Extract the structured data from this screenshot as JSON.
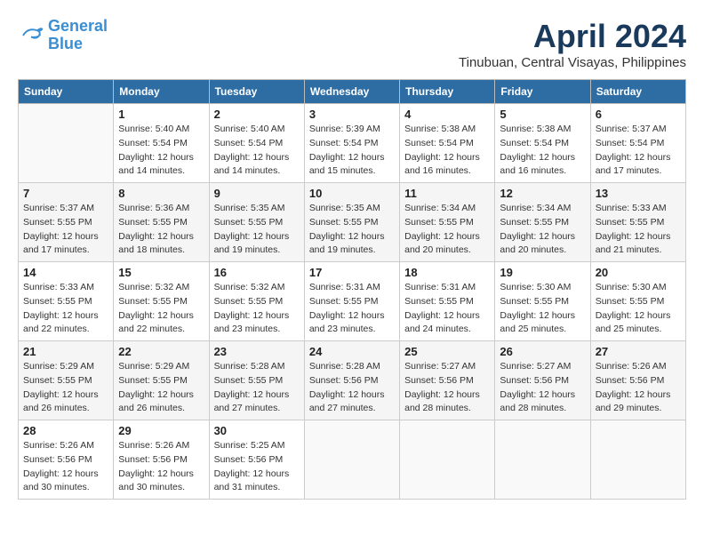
{
  "header": {
    "logo_line1": "General",
    "logo_line2": "Blue",
    "month": "April 2024",
    "location": "Tinubuan, Central Visayas, Philippines"
  },
  "days_of_week": [
    "Sunday",
    "Monday",
    "Tuesday",
    "Wednesday",
    "Thursday",
    "Friday",
    "Saturday"
  ],
  "weeks": [
    [
      {
        "day": "",
        "info": ""
      },
      {
        "day": "1",
        "info": "Sunrise: 5:40 AM\nSunset: 5:54 PM\nDaylight: 12 hours\nand 14 minutes."
      },
      {
        "day": "2",
        "info": "Sunrise: 5:40 AM\nSunset: 5:54 PM\nDaylight: 12 hours\nand 14 minutes."
      },
      {
        "day": "3",
        "info": "Sunrise: 5:39 AM\nSunset: 5:54 PM\nDaylight: 12 hours\nand 15 minutes."
      },
      {
        "day": "4",
        "info": "Sunrise: 5:38 AM\nSunset: 5:54 PM\nDaylight: 12 hours\nand 16 minutes."
      },
      {
        "day": "5",
        "info": "Sunrise: 5:38 AM\nSunset: 5:54 PM\nDaylight: 12 hours\nand 16 minutes."
      },
      {
        "day": "6",
        "info": "Sunrise: 5:37 AM\nSunset: 5:54 PM\nDaylight: 12 hours\nand 17 minutes."
      }
    ],
    [
      {
        "day": "7",
        "info": "Sunrise: 5:37 AM\nSunset: 5:55 PM\nDaylight: 12 hours\nand 17 minutes."
      },
      {
        "day": "8",
        "info": "Sunrise: 5:36 AM\nSunset: 5:55 PM\nDaylight: 12 hours\nand 18 minutes."
      },
      {
        "day": "9",
        "info": "Sunrise: 5:35 AM\nSunset: 5:55 PM\nDaylight: 12 hours\nand 19 minutes."
      },
      {
        "day": "10",
        "info": "Sunrise: 5:35 AM\nSunset: 5:55 PM\nDaylight: 12 hours\nand 19 minutes."
      },
      {
        "day": "11",
        "info": "Sunrise: 5:34 AM\nSunset: 5:55 PM\nDaylight: 12 hours\nand 20 minutes."
      },
      {
        "day": "12",
        "info": "Sunrise: 5:34 AM\nSunset: 5:55 PM\nDaylight: 12 hours\nand 20 minutes."
      },
      {
        "day": "13",
        "info": "Sunrise: 5:33 AM\nSunset: 5:55 PM\nDaylight: 12 hours\nand 21 minutes."
      }
    ],
    [
      {
        "day": "14",
        "info": "Sunrise: 5:33 AM\nSunset: 5:55 PM\nDaylight: 12 hours\nand 22 minutes."
      },
      {
        "day": "15",
        "info": "Sunrise: 5:32 AM\nSunset: 5:55 PM\nDaylight: 12 hours\nand 22 minutes."
      },
      {
        "day": "16",
        "info": "Sunrise: 5:32 AM\nSunset: 5:55 PM\nDaylight: 12 hours\nand 23 minutes."
      },
      {
        "day": "17",
        "info": "Sunrise: 5:31 AM\nSunset: 5:55 PM\nDaylight: 12 hours\nand 23 minutes."
      },
      {
        "day": "18",
        "info": "Sunrise: 5:31 AM\nSunset: 5:55 PM\nDaylight: 12 hours\nand 24 minutes."
      },
      {
        "day": "19",
        "info": "Sunrise: 5:30 AM\nSunset: 5:55 PM\nDaylight: 12 hours\nand 25 minutes."
      },
      {
        "day": "20",
        "info": "Sunrise: 5:30 AM\nSunset: 5:55 PM\nDaylight: 12 hours\nand 25 minutes."
      }
    ],
    [
      {
        "day": "21",
        "info": "Sunrise: 5:29 AM\nSunset: 5:55 PM\nDaylight: 12 hours\nand 26 minutes."
      },
      {
        "day": "22",
        "info": "Sunrise: 5:29 AM\nSunset: 5:55 PM\nDaylight: 12 hours\nand 26 minutes."
      },
      {
        "day": "23",
        "info": "Sunrise: 5:28 AM\nSunset: 5:55 PM\nDaylight: 12 hours\nand 27 minutes."
      },
      {
        "day": "24",
        "info": "Sunrise: 5:28 AM\nSunset: 5:56 PM\nDaylight: 12 hours\nand 27 minutes."
      },
      {
        "day": "25",
        "info": "Sunrise: 5:27 AM\nSunset: 5:56 PM\nDaylight: 12 hours\nand 28 minutes."
      },
      {
        "day": "26",
        "info": "Sunrise: 5:27 AM\nSunset: 5:56 PM\nDaylight: 12 hours\nand 28 minutes."
      },
      {
        "day": "27",
        "info": "Sunrise: 5:26 AM\nSunset: 5:56 PM\nDaylight: 12 hours\nand 29 minutes."
      }
    ],
    [
      {
        "day": "28",
        "info": "Sunrise: 5:26 AM\nSunset: 5:56 PM\nDaylight: 12 hours\nand 30 minutes."
      },
      {
        "day": "29",
        "info": "Sunrise: 5:26 AM\nSunset: 5:56 PM\nDaylight: 12 hours\nand 30 minutes."
      },
      {
        "day": "30",
        "info": "Sunrise: 5:25 AM\nSunset: 5:56 PM\nDaylight: 12 hours\nand 31 minutes."
      },
      {
        "day": "",
        "info": ""
      },
      {
        "day": "",
        "info": ""
      },
      {
        "day": "",
        "info": ""
      },
      {
        "day": "",
        "info": ""
      }
    ]
  ]
}
